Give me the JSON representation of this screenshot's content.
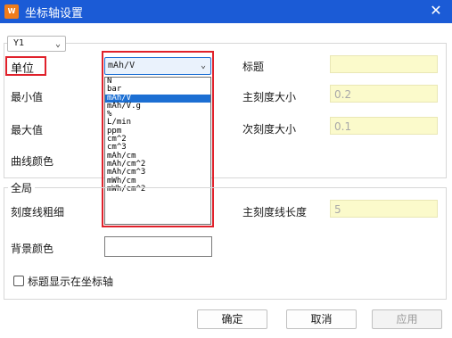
{
  "window": {
    "title": "坐标轴设置",
    "app_icon": "wps-icon"
  },
  "axis_select": {
    "value": "Y1"
  },
  "axis_group": {
    "unit_label": "单位",
    "unit_value": "mAh/V",
    "min_label": "最小值",
    "max_label": "最大值",
    "curve_color_label": "曲线颜色",
    "title_label": "标题",
    "title_value": "",
    "major_tick_label": "主刻度大小",
    "major_tick_value": "0.2",
    "minor_tick_label": "次刻度大小",
    "minor_tick_value": "0.1"
  },
  "unit_options": [
    "N",
    "bar",
    "mAh/V",
    "mAh/V.g",
    "%",
    "L/min",
    "ppm",
    "cm^2",
    "cm^3",
    "mAh/cm",
    "mAh/cm^2",
    "mAh/cm^3",
    "mWh/cm",
    "mWh/cm^2"
  ],
  "unit_selected_index": 2,
  "global_group": {
    "legend": "全局",
    "tick_width_label": "刻度线粗细",
    "major_tick_length_label": "主刻度线长度",
    "major_tick_length_value": "5",
    "bg_color_label": "背景颜色",
    "show_title_label": "标题显示在坐标轴",
    "show_title_checked": false
  },
  "buttons": {
    "ok": "确定",
    "cancel": "取消",
    "apply": "应用"
  },
  "colors": {
    "titlebar": "#1b5bd6",
    "highlight": "#e0212b",
    "field_bg": "#fbfacb",
    "selection": "#1c6fd3"
  }
}
